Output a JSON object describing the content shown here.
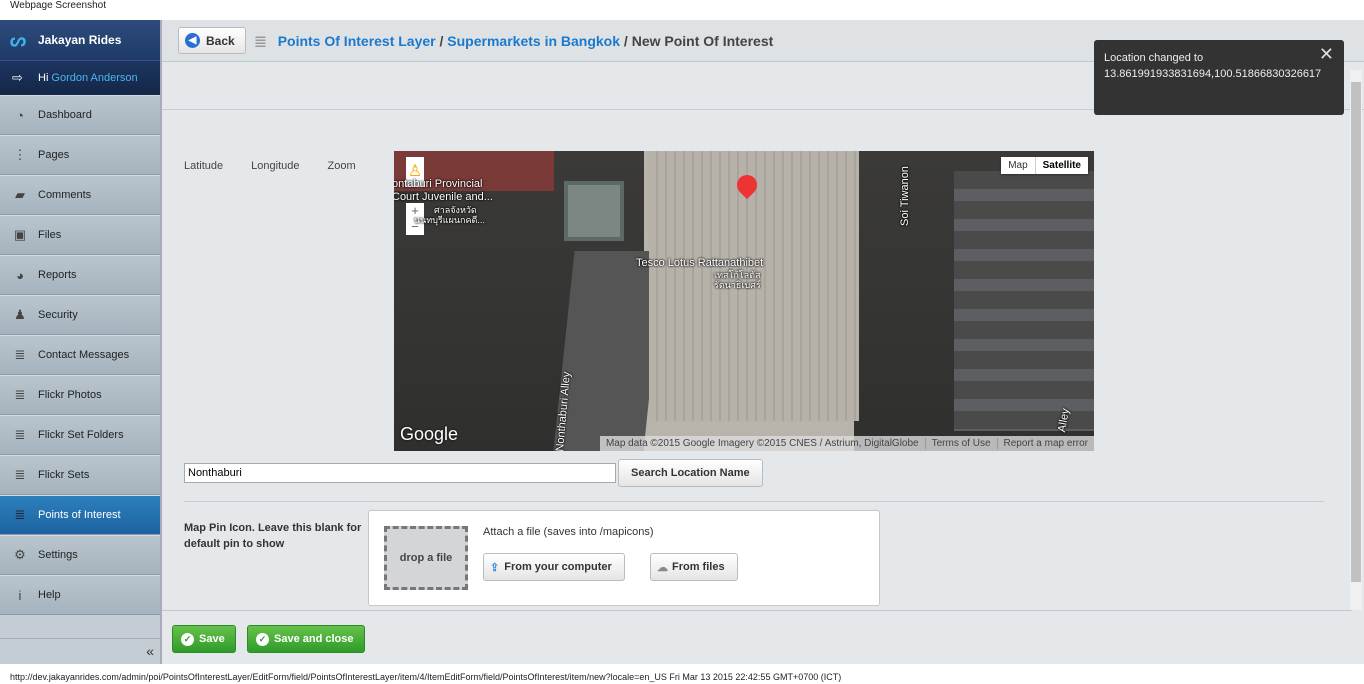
{
  "caption": "Webpage Screenshot",
  "brand": "Jakayan Rides",
  "greeting": "Hi",
  "user": "Gordon Anderson",
  "nav": [
    {
      "label": "Dashboard",
      "icon": "dashboard-icon",
      "g": "◔"
    },
    {
      "label": "Pages",
      "icon": "sitemap-icon",
      "g": "⋮"
    },
    {
      "label": "Comments",
      "icon": "comment-icon",
      "g": "▰"
    },
    {
      "label": "Files",
      "icon": "image-icon",
      "g": "▣"
    },
    {
      "label": "Reports",
      "icon": "pie-chart-icon",
      "g": "◕"
    },
    {
      "label": "Security",
      "icon": "users-icon",
      "g": "♟"
    },
    {
      "label": "Contact Messages",
      "icon": "database-icon",
      "g": "≣"
    },
    {
      "label": "Flickr Photos",
      "icon": "database-icon",
      "g": "≣"
    },
    {
      "label": "Flickr Set Folders",
      "icon": "database-icon",
      "g": "≣"
    },
    {
      "label": "Flickr Sets",
      "icon": "database-icon",
      "g": "≣"
    },
    {
      "label": "Points of Interest",
      "icon": "database-icon",
      "g": "≣"
    },
    {
      "label": "Settings",
      "icon": "gear-icon",
      "g": "⚙"
    },
    {
      "label": "Help",
      "icon": "info-icon",
      "g": "i"
    }
  ],
  "collapse": "«",
  "back": "Back",
  "crumbs": {
    "c1": "Points Of Interest Layer",
    "sep": " / ",
    "c2": "Supermarkets in Bangkok",
    "c3": "New Point Of Interest"
  },
  "fields": {
    "lat": "Latitude",
    "lng": "Longitude",
    "zoom": "Zoom"
  },
  "map": {
    "tab_map": "Map",
    "tab_sat": "Satellite",
    "l1": "ontaburi Provincial",
    "l2": "Court Juvenile and...",
    "l3": "ศาลจังหวัด",
    "l4": "นนทบุรีแผนกคดี...",
    "poi1": "Tesco Lotus Rattanathibet",
    "poi2": "เทสโก้โลตัส",
    "poi3": "รัตนาธิเบศร์",
    "road1": "Soi Tiwanon",
    "road2": "Nonthaburi Alley",
    "road3": "Alley",
    "logo": "Google",
    "attr": "Map data ©2015 Google Imagery ©2015 CNES / Astrium, DigitalGlobe",
    "terms": "Terms of Use",
    "report": "Report a map error"
  },
  "search": {
    "value": "Nonthaburi",
    "button": "Search Location Name"
  },
  "pin": {
    "label": "Map Pin Icon. Leave this blank for default pin to show",
    "drop": "drop a file",
    "attach": "Attach a file (saves into /mapicons)",
    "computer": "From your computer",
    "files": "From files"
  },
  "save": "Save",
  "save_close": "Save and close",
  "toast": {
    "title": "Location changed to",
    "coords": "13.861991933831694,100.51866830326617"
  },
  "status": "http://dev.jakayanrides.com/admin/poi/PointsOfInterestLayer/EditForm/field/PointsOfInterestLayer/item/4/ItemEditForm/field/PointsOfInterest/item/new?locale=en_US Fri Mar 13 2015 22:42:55 GMT+0700 (ICT)"
}
